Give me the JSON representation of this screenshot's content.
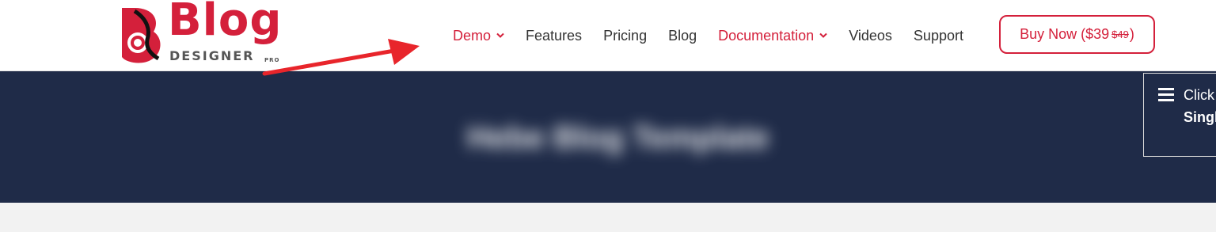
{
  "brand": {
    "word": "Blog",
    "subtitle": "DESIGNER",
    "edition": "PRO",
    "color": "#d4203b"
  },
  "nav": {
    "items": [
      {
        "label": "Demo",
        "accent": true,
        "dropdown": true
      },
      {
        "label": "Features",
        "accent": false,
        "dropdown": false
      },
      {
        "label": "Pricing",
        "accent": false,
        "dropdown": false
      },
      {
        "label": "Blog",
        "accent": false,
        "dropdown": false
      },
      {
        "label": "Documentation",
        "accent": true,
        "dropdown": true
      },
      {
        "label": "Videos",
        "accent": false,
        "dropdown": false
      },
      {
        "label": "Support",
        "accent": false,
        "dropdown": false
      }
    ]
  },
  "buy": {
    "label": "Buy Now ($39",
    "old_price": "$49",
    "close": ")"
  },
  "hero": {
    "title": "Hebe Blog Template",
    "background": "#1f2b48"
  },
  "menu_panel": {
    "line1": "Click",
    "line2": "Singl"
  },
  "annotation": {
    "arrow_color": "#e8252b"
  }
}
